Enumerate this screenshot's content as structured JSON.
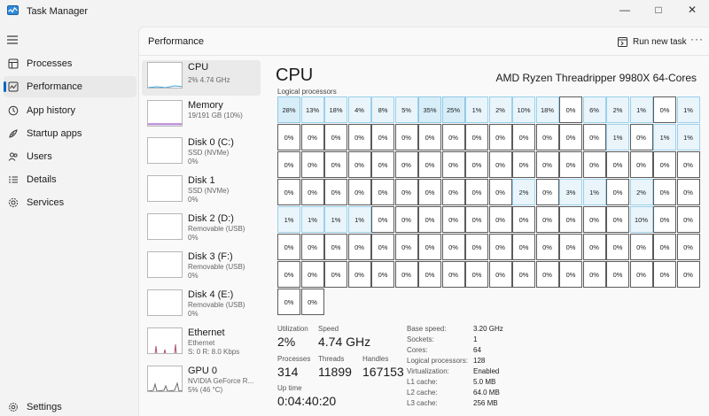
{
  "window": {
    "title": "Task Manager"
  },
  "nav": {
    "items": [
      {
        "label": "Processes",
        "icon": "processes-icon"
      },
      {
        "label": "Performance",
        "icon": "performance-icon"
      },
      {
        "label": "App history",
        "icon": "app-history-icon"
      },
      {
        "label": "Startup apps",
        "icon": "startup-apps-icon"
      },
      {
        "label": "Users",
        "icon": "users-icon"
      },
      {
        "label": "Details",
        "icon": "details-icon"
      },
      {
        "label": "Services",
        "icon": "services-icon"
      }
    ],
    "settings": "Settings",
    "selected": "Performance"
  },
  "header": {
    "title": "Performance",
    "run_new_task": "Run new task",
    "more": "···"
  },
  "resources": [
    {
      "name": "CPU",
      "sub": "2% 4.74 GHz"
    },
    {
      "name": "Memory",
      "sub": "19/191 GB (10%)"
    },
    {
      "name": "Disk 0 (C:)",
      "sub": "SSD (NVMe)",
      "sub2": "0%"
    },
    {
      "name": "Disk 1",
      "sub": "SSD (NVMe)",
      "sub2": "0%"
    },
    {
      "name": "Disk 2 (D:)",
      "sub": "Removable (USB)",
      "sub2": "0%"
    },
    {
      "name": "Disk 3 (F:)",
      "sub": "Removable (USB)",
      "sub2": "0%"
    },
    {
      "name": "Disk 4 (E:)",
      "sub": "Removable (USB)",
      "sub2": "0%"
    },
    {
      "name": "Ethernet",
      "sub": "Ethernet",
      "sub2": "S: 0 R: 8.0 Kbps"
    },
    {
      "name": "GPU 0",
      "sub": "NVIDIA GeForce R...",
      "sub2": "5% (46 °C)"
    }
  ],
  "cpu": {
    "title": "CPU",
    "model": "AMD Ryzen Threadripper 9980X 64-Cores",
    "logical_label": "Logical processors",
    "cores": [
      "28%",
      "13%",
      "18%",
      "4%",
      "8%",
      "5%",
      "35%",
      "25%",
      "1%",
      "2%",
      "10%",
      "18%",
      "0%",
      "6%",
      "2%",
      "1%",
      "0%",
      "1%",
      "0%",
      "0%",
      "0%",
      "0%",
      "0%",
      "0%",
      "0%",
      "0%",
      "0%",
      "0%",
      "0%",
      "0%",
      "0%",
      "0%",
      "1%",
      "0%",
      "1%",
      "1%",
      "0%",
      "0%",
      "0%",
      "0%",
      "0%",
      "0%",
      "0%",
      "0%",
      "0%",
      "0%",
      "0%",
      "0%",
      "0%",
      "0%",
      "0%",
      "0%",
      "0%",
      "0%",
      "0%",
      "0%",
      "0%",
      "0%",
      "0%",
      "0%",
      "0%",
      "0%",
      "0%",
      "0%",
      "2%",
      "0%",
      "3%",
      "1%",
      "0%",
      "2%",
      "0%",
      "0%",
      "1%",
      "1%",
      "1%",
      "1%",
      "0%",
      "0%",
      "0%",
      "0%",
      "0%",
      "0%",
      "0%",
      "0%",
      "0%",
      "0%",
      "0%",
      "10%",
      "0%",
      "0%",
      "0%",
      "0%",
      "0%",
      "0%",
      "0%",
      "0%",
      "0%",
      "0%",
      "0%",
      "0%",
      "0%",
      "0%",
      "0%",
      "0%",
      "0%",
      "0%",
      "0%",
      "0%",
      "0%",
      "0%",
      "0%",
      "0%",
      "0%",
      "0%",
      "0%",
      "0%",
      "0%",
      "0%",
      "0%",
      "0%",
      "0%",
      "0%",
      "0%",
      "0%",
      "0%",
      "0%",
      "0%",
      "0%"
    ],
    "stats": {
      "utilization_label": "Utilization",
      "utilization": "2%",
      "speed_label": "Speed",
      "speed": "4.74 GHz",
      "processes_label": "Processes",
      "processes": "314",
      "threads_label": "Threads",
      "threads": "11899",
      "handles_label": "Handles",
      "handles": "167153",
      "uptime_label": "Up time",
      "uptime": "0:04:40:20"
    },
    "details": [
      {
        "k": "Base speed:",
        "v": "3.20 GHz"
      },
      {
        "k": "Sockets:",
        "v": "1"
      },
      {
        "k": "Cores:",
        "v": "64"
      },
      {
        "k": "Logical processors:",
        "v": "128"
      },
      {
        "k": "Virtualization:",
        "v": "Enabled"
      },
      {
        "k": "L1 cache:",
        "v": "5.0 MB"
      },
      {
        "k": "L2 cache:",
        "v": "64.0 MB"
      },
      {
        "k": "L3 cache:",
        "v": "256 MB"
      }
    ]
  },
  "colors": {
    "accent": "#0067c0",
    "cpu_line": "#3ba3d6",
    "memory_line": "#8a3fbf",
    "ethernet_line": "#b0546b",
    "gpu_line": "#6b6b6b"
  }
}
